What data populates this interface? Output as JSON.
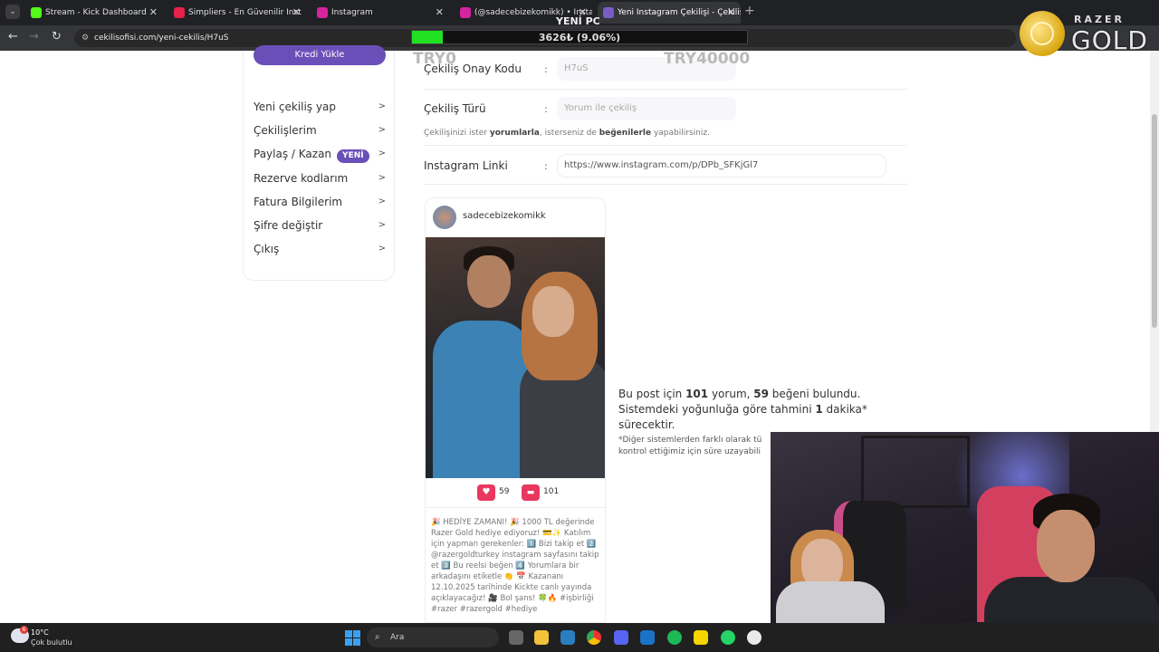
{
  "browser": {
    "tabs": [
      {
        "label": "Stream - Kick Dashboard",
        "color": "#53fc18",
        "active": false
      },
      {
        "label": "Simpliers - En Güvenilir Inst",
        "color": "#e6224b",
        "active": false
      },
      {
        "label": "Instagram",
        "color": "#d6249f",
        "active": false
      },
      {
        "label": "(@sadecebizekomikk) • Instagr",
        "color": "#d6249f",
        "active": false
      },
      {
        "label": "Yeni Instagram Çekilişi - Çekiliş",
        "color": "#7a5cc8",
        "active": true
      }
    ],
    "url": "cekilisofisi.com/yeni-cekilis/H7uS"
  },
  "overlay": {
    "goal_title": "YENİ PC",
    "progress_text": "3626₺ (9.06%)",
    "progress_fraction": 0.0906,
    "progress_color": "#22e022",
    "start_amount": "TRY0",
    "goal_amount": "TRY40000",
    "brand_top": "RAZER",
    "brand_main": "GOLD"
  },
  "sidebar": {
    "top_button": "Kredi Yükle",
    "items": [
      {
        "label": "Yeni çekiliş yap",
        "arrow": ">"
      },
      {
        "label": "Çekilişlerim",
        "arrow": ">"
      },
      {
        "label": "Paylaş / Kazan",
        "badge": "YENİ",
        "arrow": ">"
      },
      {
        "label": "Rezerve kodlarım",
        "arrow": ">"
      },
      {
        "label": "Fatura Bilgilerim",
        "arrow": ">"
      },
      {
        "label": "Şifre değiştir",
        "arrow": ">"
      },
      {
        "label": "Çıkış",
        "arrow": ">"
      }
    ]
  },
  "form": {
    "code_label": "Çekiliş Onay Kodu",
    "code_value": "H7uS",
    "type_label": "Çekiliş Türü",
    "type_value": "Yorum ile çekiliş",
    "hint_part1": "Çekilişinizi ister ",
    "hint_bold1": "yorumlarla",
    "hint_part2": ", isterseniz de ",
    "hint_bold2": "beğenilerle",
    "hint_part3": " yapabilirsiniz.",
    "link_label": "Instagram Linki",
    "link_value": "https://www.instagram.com/p/DPb_SFKjGl7",
    "colon": ":"
  },
  "post": {
    "username": "sadecebizekomikk",
    "likes": "59",
    "comments": "101",
    "caption": "🎉 HEDİYE ZAMANI! 🎉 1000 TL değerinde Razer Gold hediye ediyoruz! 💳✨ Katılım için yapman gerekenler: 1️⃣ Bizi takip et 2️⃣ @razergoldturkey instagram sayfasını takip et 3️⃣ Bu reelsi beğen 4️⃣ Yorumlara bir arkadaşını etiketle 👏 📅 Kazananı 12.10.2025 tarihinde Kickte canlı yayında açıklayacağız! 🎥 Bol şans! 🍀🔥 #işbirliği #razer #razergold #hediye"
  },
  "info": {
    "t1": "Bu post için ",
    "comments": "101",
    "t2": " yorum, ",
    "likes": "59",
    "t3": " beğeni bulundu. Sistemdeki yoğunluğa göre tahmini ",
    "minutes": "1",
    "t4": " dakika* sürecektir.",
    "note_line1": "*Diğer sistemlerden farklı olarak tü",
    "note_line2": "kontrol ettiğimiz için süre uzayabili"
  },
  "taskbar": {
    "temperature": "10°C",
    "condition": "Çok bulutlu",
    "weather_badge": "6",
    "search_placeholder": "Ara"
  }
}
